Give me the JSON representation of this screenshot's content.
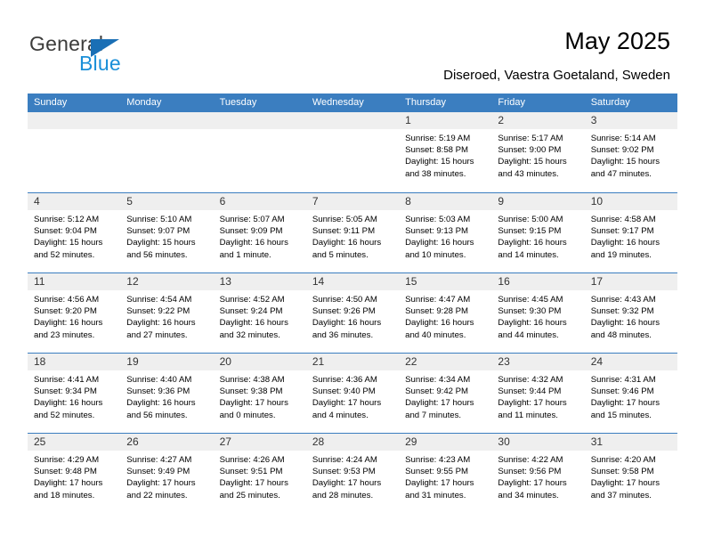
{
  "brand": {
    "name_part1": "General",
    "name_part2": "Blue",
    "triangle_icon": "triangle-icon",
    "accent_color": "#1a8fd8",
    "header_color": "#3b7ec0"
  },
  "header": {
    "title": "May 2025",
    "subtitle": "Diseroed, Vaestra Goetaland, Sweden"
  },
  "calendar": {
    "weekdays": [
      "Sunday",
      "Monday",
      "Tuesday",
      "Wednesday",
      "Thursday",
      "Friday",
      "Saturday"
    ],
    "weeks": [
      [
        {
          "day": "",
          "lines": []
        },
        {
          "day": "",
          "lines": []
        },
        {
          "day": "",
          "lines": []
        },
        {
          "day": "",
          "lines": []
        },
        {
          "day": "1",
          "lines": [
            "Sunrise: 5:19 AM",
            "Sunset: 8:58 PM",
            "Daylight: 15 hours",
            "and 38 minutes."
          ]
        },
        {
          "day": "2",
          "lines": [
            "Sunrise: 5:17 AM",
            "Sunset: 9:00 PM",
            "Daylight: 15 hours",
            "and 43 minutes."
          ]
        },
        {
          "day": "3",
          "lines": [
            "Sunrise: 5:14 AM",
            "Sunset: 9:02 PM",
            "Daylight: 15 hours",
            "and 47 minutes."
          ]
        }
      ],
      [
        {
          "day": "4",
          "lines": [
            "Sunrise: 5:12 AM",
            "Sunset: 9:04 PM",
            "Daylight: 15 hours",
            "and 52 minutes."
          ]
        },
        {
          "day": "5",
          "lines": [
            "Sunrise: 5:10 AM",
            "Sunset: 9:07 PM",
            "Daylight: 15 hours",
            "and 56 minutes."
          ]
        },
        {
          "day": "6",
          "lines": [
            "Sunrise: 5:07 AM",
            "Sunset: 9:09 PM",
            "Daylight: 16 hours",
            "and 1 minute."
          ]
        },
        {
          "day": "7",
          "lines": [
            "Sunrise: 5:05 AM",
            "Sunset: 9:11 PM",
            "Daylight: 16 hours",
            "and 5 minutes."
          ]
        },
        {
          "day": "8",
          "lines": [
            "Sunrise: 5:03 AM",
            "Sunset: 9:13 PM",
            "Daylight: 16 hours",
            "and 10 minutes."
          ]
        },
        {
          "day": "9",
          "lines": [
            "Sunrise: 5:00 AM",
            "Sunset: 9:15 PM",
            "Daylight: 16 hours",
            "and 14 minutes."
          ]
        },
        {
          "day": "10",
          "lines": [
            "Sunrise: 4:58 AM",
            "Sunset: 9:17 PM",
            "Daylight: 16 hours",
            "and 19 minutes."
          ]
        }
      ],
      [
        {
          "day": "11",
          "lines": [
            "Sunrise: 4:56 AM",
            "Sunset: 9:20 PM",
            "Daylight: 16 hours",
            "and 23 minutes."
          ]
        },
        {
          "day": "12",
          "lines": [
            "Sunrise: 4:54 AM",
            "Sunset: 9:22 PM",
            "Daylight: 16 hours",
            "and 27 minutes."
          ]
        },
        {
          "day": "13",
          "lines": [
            "Sunrise: 4:52 AM",
            "Sunset: 9:24 PM",
            "Daylight: 16 hours",
            "and 32 minutes."
          ]
        },
        {
          "day": "14",
          "lines": [
            "Sunrise: 4:50 AM",
            "Sunset: 9:26 PM",
            "Daylight: 16 hours",
            "and 36 minutes."
          ]
        },
        {
          "day": "15",
          "lines": [
            "Sunrise: 4:47 AM",
            "Sunset: 9:28 PM",
            "Daylight: 16 hours",
            "and 40 minutes."
          ]
        },
        {
          "day": "16",
          "lines": [
            "Sunrise: 4:45 AM",
            "Sunset: 9:30 PM",
            "Daylight: 16 hours",
            "and 44 minutes."
          ]
        },
        {
          "day": "17",
          "lines": [
            "Sunrise: 4:43 AM",
            "Sunset: 9:32 PM",
            "Daylight: 16 hours",
            "and 48 minutes."
          ]
        }
      ],
      [
        {
          "day": "18",
          "lines": [
            "Sunrise: 4:41 AM",
            "Sunset: 9:34 PM",
            "Daylight: 16 hours",
            "and 52 minutes."
          ]
        },
        {
          "day": "19",
          "lines": [
            "Sunrise: 4:40 AM",
            "Sunset: 9:36 PM",
            "Daylight: 16 hours",
            "and 56 minutes."
          ]
        },
        {
          "day": "20",
          "lines": [
            "Sunrise: 4:38 AM",
            "Sunset: 9:38 PM",
            "Daylight: 17 hours",
            "and 0 minutes."
          ]
        },
        {
          "day": "21",
          "lines": [
            "Sunrise: 4:36 AM",
            "Sunset: 9:40 PM",
            "Daylight: 17 hours",
            "and 4 minutes."
          ]
        },
        {
          "day": "22",
          "lines": [
            "Sunrise: 4:34 AM",
            "Sunset: 9:42 PM",
            "Daylight: 17 hours",
            "and 7 minutes."
          ]
        },
        {
          "day": "23",
          "lines": [
            "Sunrise: 4:32 AM",
            "Sunset: 9:44 PM",
            "Daylight: 17 hours",
            "and 11 minutes."
          ]
        },
        {
          "day": "24",
          "lines": [
            "Sunrise: 4:31 AM",
            "Sunset: 9:46 PM",
            "Daylight: 17 hours",
            "and 15 minutes."
          ]
        }
      ],
      [
        {
          "day": "25",
          "lines": [
            "Sunrise: 4:29 AM",
            "Sunset: 9:48 PM",
            "Daylight: 17 hours",
            "and 18 minutes."
          ]
        },
        {
          "day": "26",
          "lines": [
            "Sunrise: 4:27 AM",
            "Sunset: 9:49 PM",
            "Daylight: 17 hours",
            "and 22 minutes."
          ]
        },
        {
          "day": "27",
          "lines": [
            "Sunrise: 4:26 AM",
            "Sunset: 9:51 PM",
            "Daylight: 17 hours",
            "and 25 minutes."
          ]
        },
        {
          "day": "28",
          "lines": [
            "Sunrise: 4:24 AM",
            "Sunset: 9:53 PM",
            "Daylight: 17 hours",
            "and 28 minutes."
          ]
        },
        {
          "day": "29",
          "lines": [
            "Sunrise: 4:23 AM",
            "Sunset: 9:55 PM",
            "Daylight: 17 hours",
            "and 31 minutes."
          ]
        },
        {
          "day": "30",
          "lines": [
            "Sunrise: 4:22 AM",
            "Sunset: 9:56 PM",
            "Daylight: 17 hours",
            "and 34 minutes."
          ]
        },
        {
          "day": "31",
          "lines": [
            "Sunrise: 4:20 AM",
            "Sunset: 9:58 PM",
            "Daylight: 17 hours",
            "and 37 minutes."
          ]
        }
      ]
    ]
  }
}
